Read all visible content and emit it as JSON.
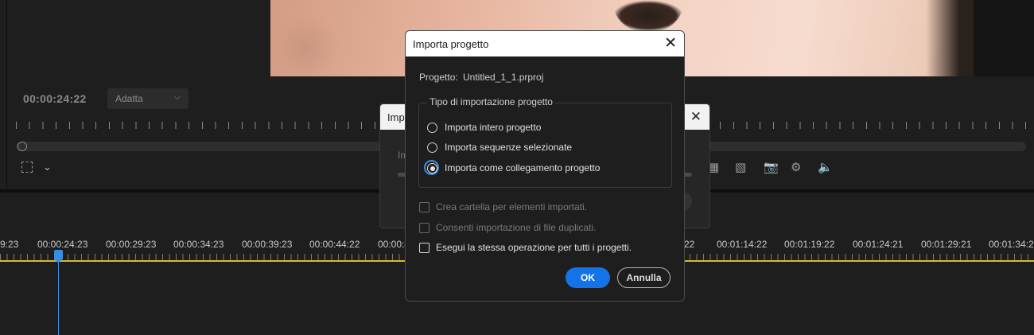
{
  "monitor": {
    "timecode": "00:00:24:22",
    "fit_dropdown": "Adatta",
    "right_icons": [
      "insert-icon",
      "overwrite-icon",
      "camera-icon",
      "settings-icon",
      "volume-icon"
    ]
  },
  "timeline": {
    "labels": [
      "9:23",
      "00:00:24:23",
      "00:00:29:23",
      "00:00:34:23",
      "00:00:39:23",
      "00:00:44:22",
      "00:00:4",
      "22",
      "00:01:14:22",
      "00:01:19:22",
      "00:01:24:21",
      "00:01:29:21",
      "00:01:34:21"
    ]
  },
  "bg_dialog": {
    "title": "Impo",
    "im_text": "Im"
  },
  "dialog": {
    "title": "Importa progetto",
    "close": "✕",
    "project_label": "Progetto:",
    "project_value": "Untitled_1_1.prproj",
    "group_title": "Tipo di importazione progetto",
    "radio_options": [
      {
        "label": "Importa intero progetto",
        "selected": false
      },
      {
        "label": "Importa sequenze selezionate",
        "selected": false
      },
      {
        "label": "Importa come collegamento progetto",
        "selected": true
      }
    ],
    "checkboxes": [
      {
        "label": "Crea cartella per elementi importati.",
        "enabled": false
      },
      {
        "label": "Consenti importazione di file duplicati.",
        "enabled": false
      },
      {
        "label": "Esegui la stessa operazione per tutti i progetti.",
        "enabled": true
      }
    ],
    "ok_label": "OK",
    "cancel_label": "Annulla"
  }
}
